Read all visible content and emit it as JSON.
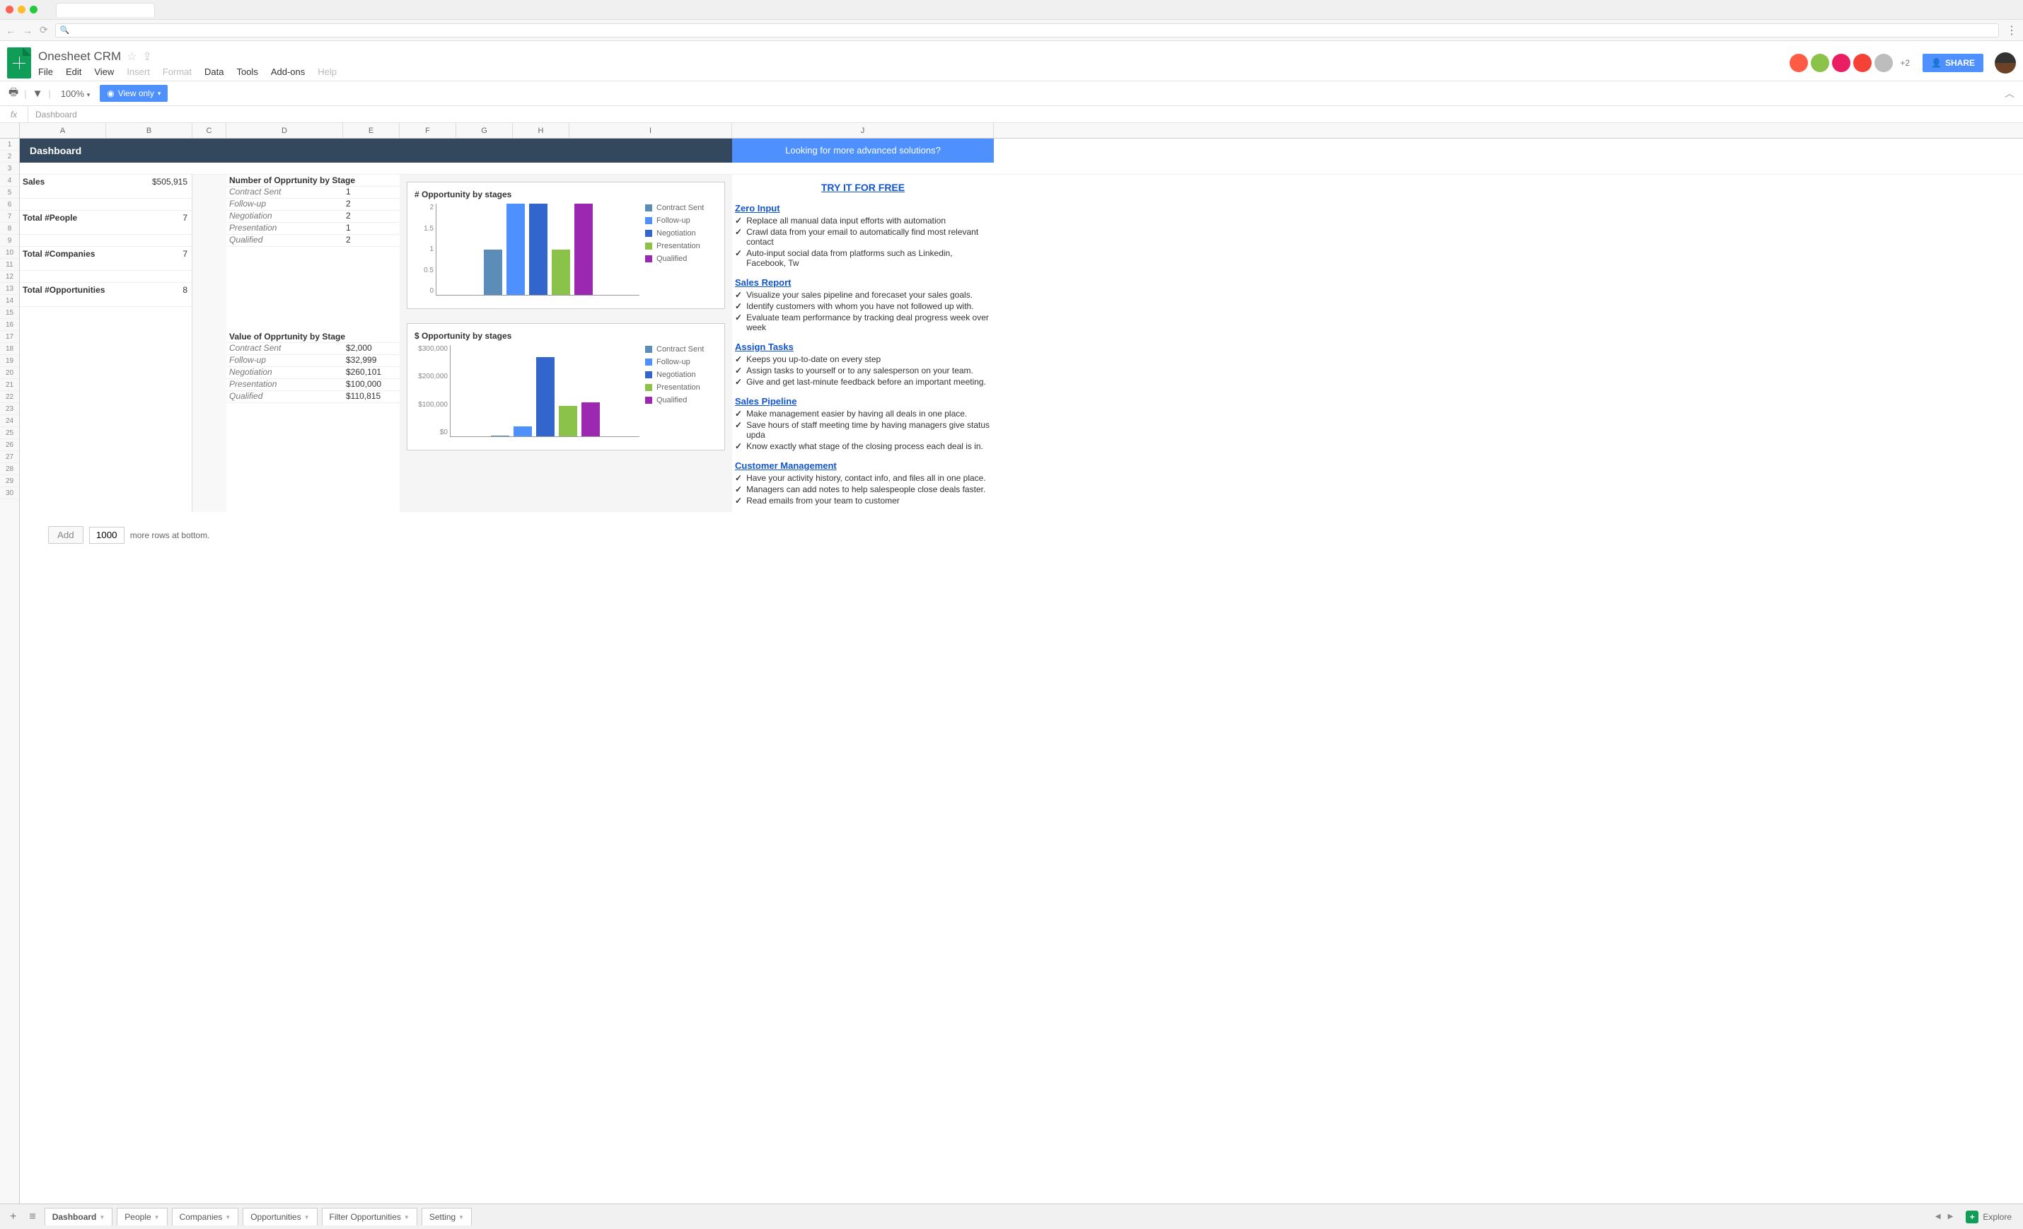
{
  "doc": {
    "title": "Onesheet CRM"
  },
  "menu": [
    "File",
    "Edit",
    "View",
    "Insert",
    "Format",
    "Data",
    "Tools",
    "Add-ons",
    "Help"
  ],
  "menu_disabled": [
    3,
    4,
    8
  ],
  "collab": {
    "plus": "+2",
    "share": "SHARE"
  },
  "toolbar": {
    "zoom": "100%",
    "view_only": "View only"
  },
  "formula": {
    "fx": "fx",
    "value": "Dashboard"
  },
  "cols": [
    "A",
    "B",
    "C",
    "D",
    "E",
    "F",
    "G",
    "H",
    "I",
    "J"
  ],
  "banner": {
    "dash": "Dashboard",
    "promo": "Looking for more advanced solutions?"
  },
  "metrics": {
    "sales_label": "Sales",
    "sales_val": "$505,915",
    "people_label": "Total #People",
    "people_val": "7",
    "companies_label": "Total #Companies",
    "companies_val": "7",
    "opps_label": "Total #Opportunities",
    "opps_val": "8"
  },
  "num_stage": {
    "title": "Number of Opprtunity by Stage",
    "rows": [
      [
        "Contract Sent",
        "1"
      ],
      [
        "Follow-up",
        "2"
      ],
      [
        "Negotiation",
        "2"
      ],
      [
        "Presentation",
        "1"
      ],
      [
        "Qualified",
        "2"
      ]
    ]
  },
  "val_stage": {
    "title": "Value of Opprtunity by Stage",
    "rows": [
      [
        "Contract Sent",
        "$2,000"
      ],
      [
        "Follow-up",
        "$32,999"
      ],
      [
        "Negotiation",
        "$260,101"
      ],
      [
        "Presentation",
        "$100,000"
      ],
      [
        "Qualified",
        "$110,815"
      ]
    ]
  },
  "chart_data": [
    {
      "type": "bar",
      "title": "# Opportunity by stages",
      "categories": [
        "Contract Sent",
        "Follow-up",
        "Negotiation",
        "Presentation",
        "Qualified"
      ],
      "values": [
        1,
        2,
        2,
        1,
        2
      ],
      "ylim": [
        0,
        2
      ],
      "yticks": [
        "0",
        "0.5",
        "1",
        "1.5",
        "2"
      ],
      "colors": [
        "#5b8db8",
        "#4d90fe",
        "#3366cc",
        "#8bc34a",
        "#9c27b0"
      ]
    },
    {
      "type": "bar",
      "title": "$ Opportunity by stages",
      "categories": [
        "Contract Sent",
        "Follow-up",
        "Negotiation",
        "Presentation",
        "Qualified"
      ],
      "values": [
        2000,
        32999,
        260101,
        100000,
        110815
      ],
      "ylim": [
        0,
        300000
      ],
      "yticks": [
        "$0",
        "$100,000",
        "$200,000",
        "$300,000"
      ],
      "colors": [
        "#5b8db8",
        "#4d90fe",
        "#3366cc",
        "#8bc34a",
        "#9c27b0"
      ]
    }
  ],
  "promo": {
    "try": "TRY IT FOR FREE",
    "sections": [
      {
        "title": "Zero Input",
        "bullets": [
          "Replace all manual data input efforts with automation",
          "Crawl data from your email to automatically find most relevant contact",
          "Auto-input social data from platforms such as Linkedin, Facebook, Tw"
        ]
      },
      {
        "title": "Sales Report",
        "bullets": [
          "Visualize your sales pipeline and forecaset your sales goals.",
          "Identify customers with whom you have not followed up with.",
          "Evaluate team performance by tracking deal progress week over week"
        ]
      },
      {
        "title": "Assign Tasks ",
        "bullets": [
          "Keeps you up-to-date on every step",
          "Assign tasks to yourself or to any salesperson on your team.",
          "Give and get last-minute feedback before an important meeting."
        ]
      },
      {
        "title": "Sales Pipeline",
        "bullets": [
          "Make management easier by having all deals in one place.",
          "Save hours of staff meeting time by having managers give status upda",
          "Know exactly what stage of the closing process each deal is in."
        ]
      },
      {
        "title": "Customer Management",
        "bullets": [
          "Have your activity history, contact info, and files all in one place.",
          "Managers can add notes to help salespeople close deals faster.",
          "Read emails from your team to customer"
        ]
      }
    ]
  },
  "adder": {
    "add": "Add",
    "count": "1000",
    "tail": "more rows at bottom."
  },
  "tabs": [
    "Dashboard",
    "People",
    "Companies",
    "Opportunities",
    "Filter Opportunities",
    "Setting"
  ],
  "explore": "Explore"
}
